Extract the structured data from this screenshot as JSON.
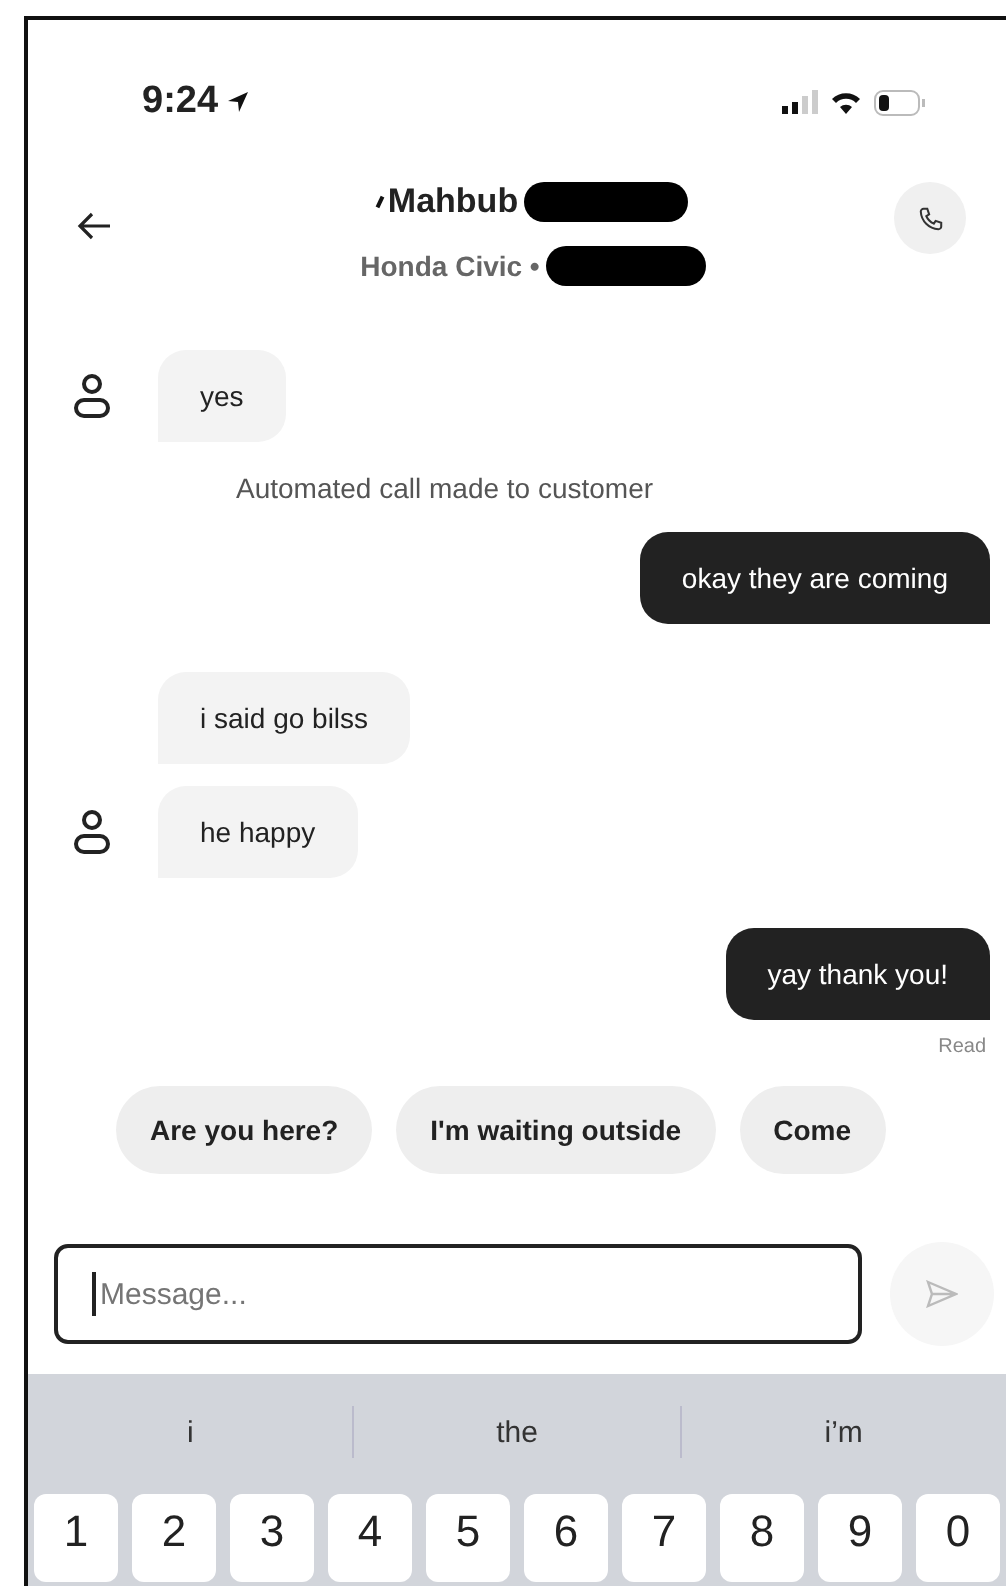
{
  "status_bar": {
    "time": "9:24"
  },
  "header": {
    "title": "Mahbub",
    "subtitle": "Honda Civic •"
  },
  "messages": [
    {
      "kind": "incoming",
      "text": "yes",
      "avatar": true
    },
    {
      "kind": "system",
      "text": "Automated call made to customer"
    },
    {
      "kind": "outgoing",
      "text": "okay they are coming"
    },
    {
      "kind": "incoming",
      "text": "i said go bilss",
      "avatar": false
    },
    {
      "kind": "incoming",
      "text": "he happy",
      "avatar": true
    },
    {
      "kind": "outgoing",
      "text": "yay thank you!"
    }
  ],
  "read_receipt": "Read",
  "quick_replies": [
    "Are you here?",
    "I'm waiting outside",
    "Come"
  ],
  "composer": {
    "placeholder": "Message..."
  },
  "keyboard": {
    "suggestions": [
      "i",
      "the",
      "i’m"
    ],
    "keys": [
      "1",
      "2",
      "3",
      "4",
      "5",
      "6",
      "7",
      "8",
      "9",
      "0"
    ]
  }
}
